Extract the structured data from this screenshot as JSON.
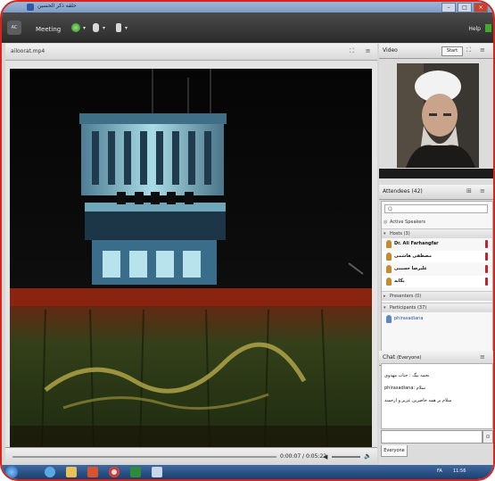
{
  "window": {
    "title": "حلقه ذکر الحسین",
    "buttons": [
      "–",
      "□",
      "×"
    ]
  },
  "toolbar": {
    "logo_text": "AC",
    "meeting_label": "Meeting",
    "help_label": "Help"
  },
  "share_pod": {
    "file_name": "ailoorat.mp4"
  },
  "player": {
    "time": "0:00:07 / 0:05:22"
  },
  "video_pod": {
    "title": "Video",
    "start_button": "Start"
  },
  "attendees": {
    "title": "Attendees",
    "count": "(42)",
    "search_placeholder": "Q",
    "active_speakers": "Active Speakers",
    "hosts_group": "Hosts (3)",
    "hosts": [
      "Dr. Ali Farhangfar",
      "مصطفی هاشمی",
      "علیرضا حسینی",
      "یگانه"
    ],
    "presenters_group": "Presenters (0)",
    "participants_group": "Participants (37)",
    "participants": [
      "phirasadiana"
    ]
  },
  "chat": {
    "title": "Chat",
    "scope": "(Everyone)",
    "lines": [
      "نجمه بیگ : جناب مهدوی",
      "phirasadiana: سلام",
      "سلام بر همه حاضرین عزیز و ارجمند"
    ],
    "tab_label": "Everyone"
  },
  "taskbar": {
    "lang": "FA",
    "time": "11:56"
  },
  "colors": {
    "frame_border": "#d9231d",
    "toolbar": "#3a3a3a",
    "status_red": "#c0242b"
  }
}
